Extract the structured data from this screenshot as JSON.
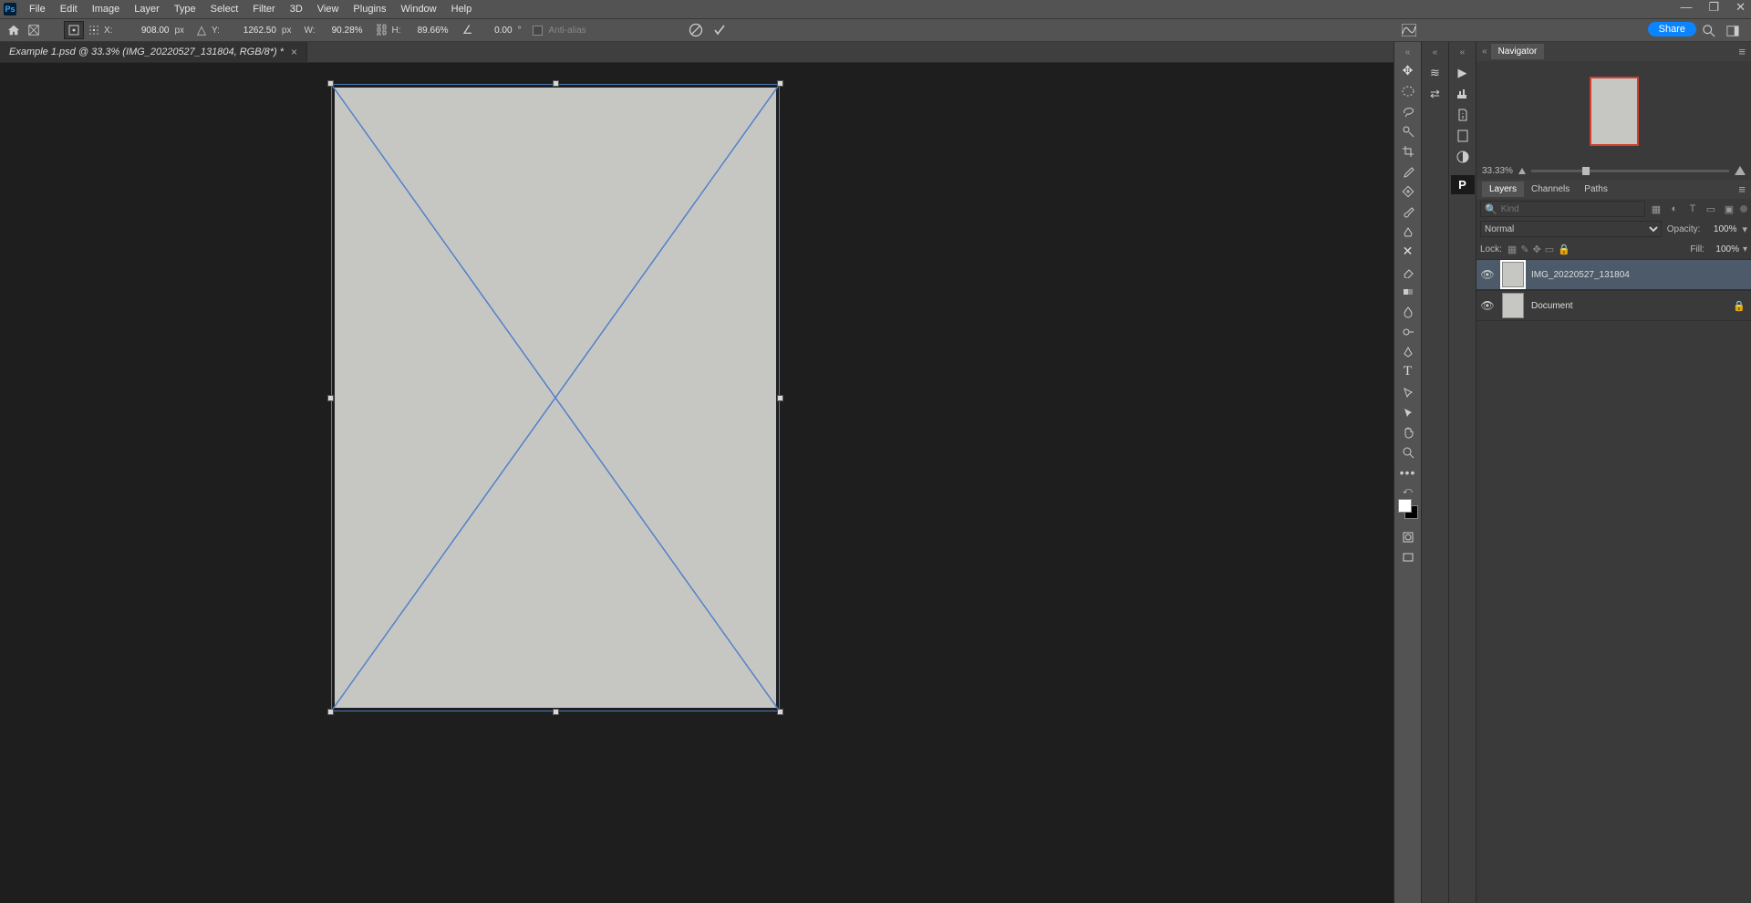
{
  "app_logo": "Ps",
  "menu": [
    "File",
    "Edit",
    "Image",
    "Layer",
    "Type",
    "Select",
    "Filter",
    "3D",
    "View",
    "Plugins",
    "Window",
    "Help"
  ],
  "window_controls": {
    "min": "—",
    "max": "❐",
    "close": "✕"
  },
  "options": {
    "x_label": "X:",
    "x_value": "908.00",
    "x_unit": "px",
    "y_label": "Y:",
    "y_value": "1262.50",
    "y_unit": "px",
    "w_label": "W:",
    "w_value": "90.28%",
    "h_label": "H:",
    "h_value": "89.66%",
    "rot_value": "0.00",
    "rot_deg": "°",
    "interp_label": "Anti-alias"
  },
  "share_label": "Share",
  "doc_tab": "Example 1.psd @ 33.3% (IMG_20220527_131804, RGB/8*) *",
  "navigator": {
    "title": "Navigator",
    "zoom": "33.33%"
  },
  "layers_panel": {
    "tabs": [
      "Layers",
      "Channels",
      "Paths"
    ],
    "kind_placeholder": "Kind",
    "blend_mode": "Normal",
    "opacity_label": "Opacity:",
    "opacity": "100%",
    "lock_label": "Lock:",
    "fill_label": "Fill:",
    "fill": "100%",
    "layers": [
      {
        "name": "IMG_20220527_131804",
        "locked": false,
        "selected": true
      },
      {
        "name": "Document",
        "locked": true,
        "selected": false
      }
    ]
  }
}
